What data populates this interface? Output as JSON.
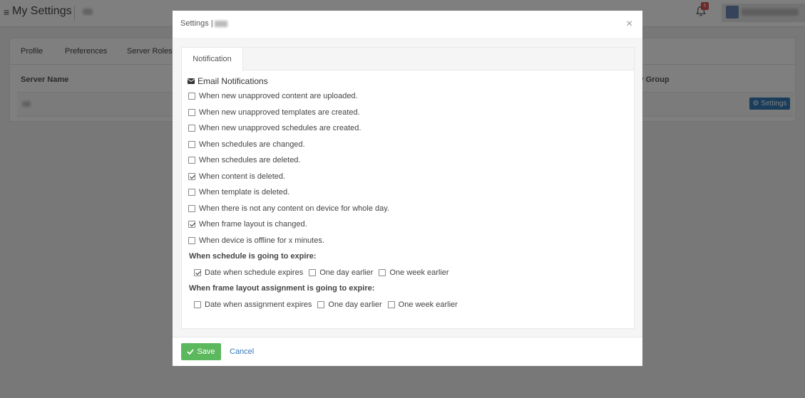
{
  "app": {
    "menu_glyph": "≡",
    "page_title": "My Settings",
    "notification_count": "5"
  },
  "background": {
    "tabs": [
      "Profile",
      "Preferences",
      "Server Roles"
    ],
    "table_headers": {
      "server_name": "Server Name",
      "group": "ary Group"
    },
    "row_settings_label": "Settings"
  },
  "modal": {
    "title": "Settings |",
    "close_glyph": "×",
    "tab_label": "Notification",
    "section_title": "Email Notifications",
    "options": [
      {
        "label": "When new unapproved content are uploaded.",
        "checked": false
      },
      {
        "label": "When new unapproved templates are created.",
        "checked": false
      },
      {
        "label": "When new unapproved schedules are created.",
        "checked": false
      },
      {
        "label": "When schedules are changed.",
        "checked": false
      },
      {
        "label": "When schedules are deleted.",
        "checked": false
      },
      {
        "label": "When content is deleted.",
        "checked": true
      },
      {
        "label": "When template is deleted.",
        "checked": false
      },
      {
        "label": "When there is not any content on device for whole day.",
        "checked": false
      },
      {
        "label": "When frame layout is changed.",
        "checked": true
      },
      {
        "label": "When device is offline for x minutes.",
        "checked": false
      }
    ],
    "schedule_expire": {
      "label": "When schedule is going to expire:",
      "choices": [
        {
          "label": "Date when schedule expires",
          "checked": true
        },
        {
          "label": "One day earlier",
          "checked": false
        },
        {
          "label": "One week earlier",
          "checked": false
        }
      ]
    },
    "frame_expire": {
      "label": "When frame layout assignment is going to expire:",
      "choices": [
        {
          "label": "Date when assignment expires",
          "checked": false
        },
        {
          "label": "One day earlier",
          "checked": false
        },
        {
          "label": "One week earlier",
          "checked": false
        }
      ]
    },
    "save_label": "Save",
    "cancel_label": "Cancel"
  },
  "colors": {
    "save_green": "#5cb85c",
    "link_blue": "#337ab7",
    "badge_red": "#d9534f"
  }
}
